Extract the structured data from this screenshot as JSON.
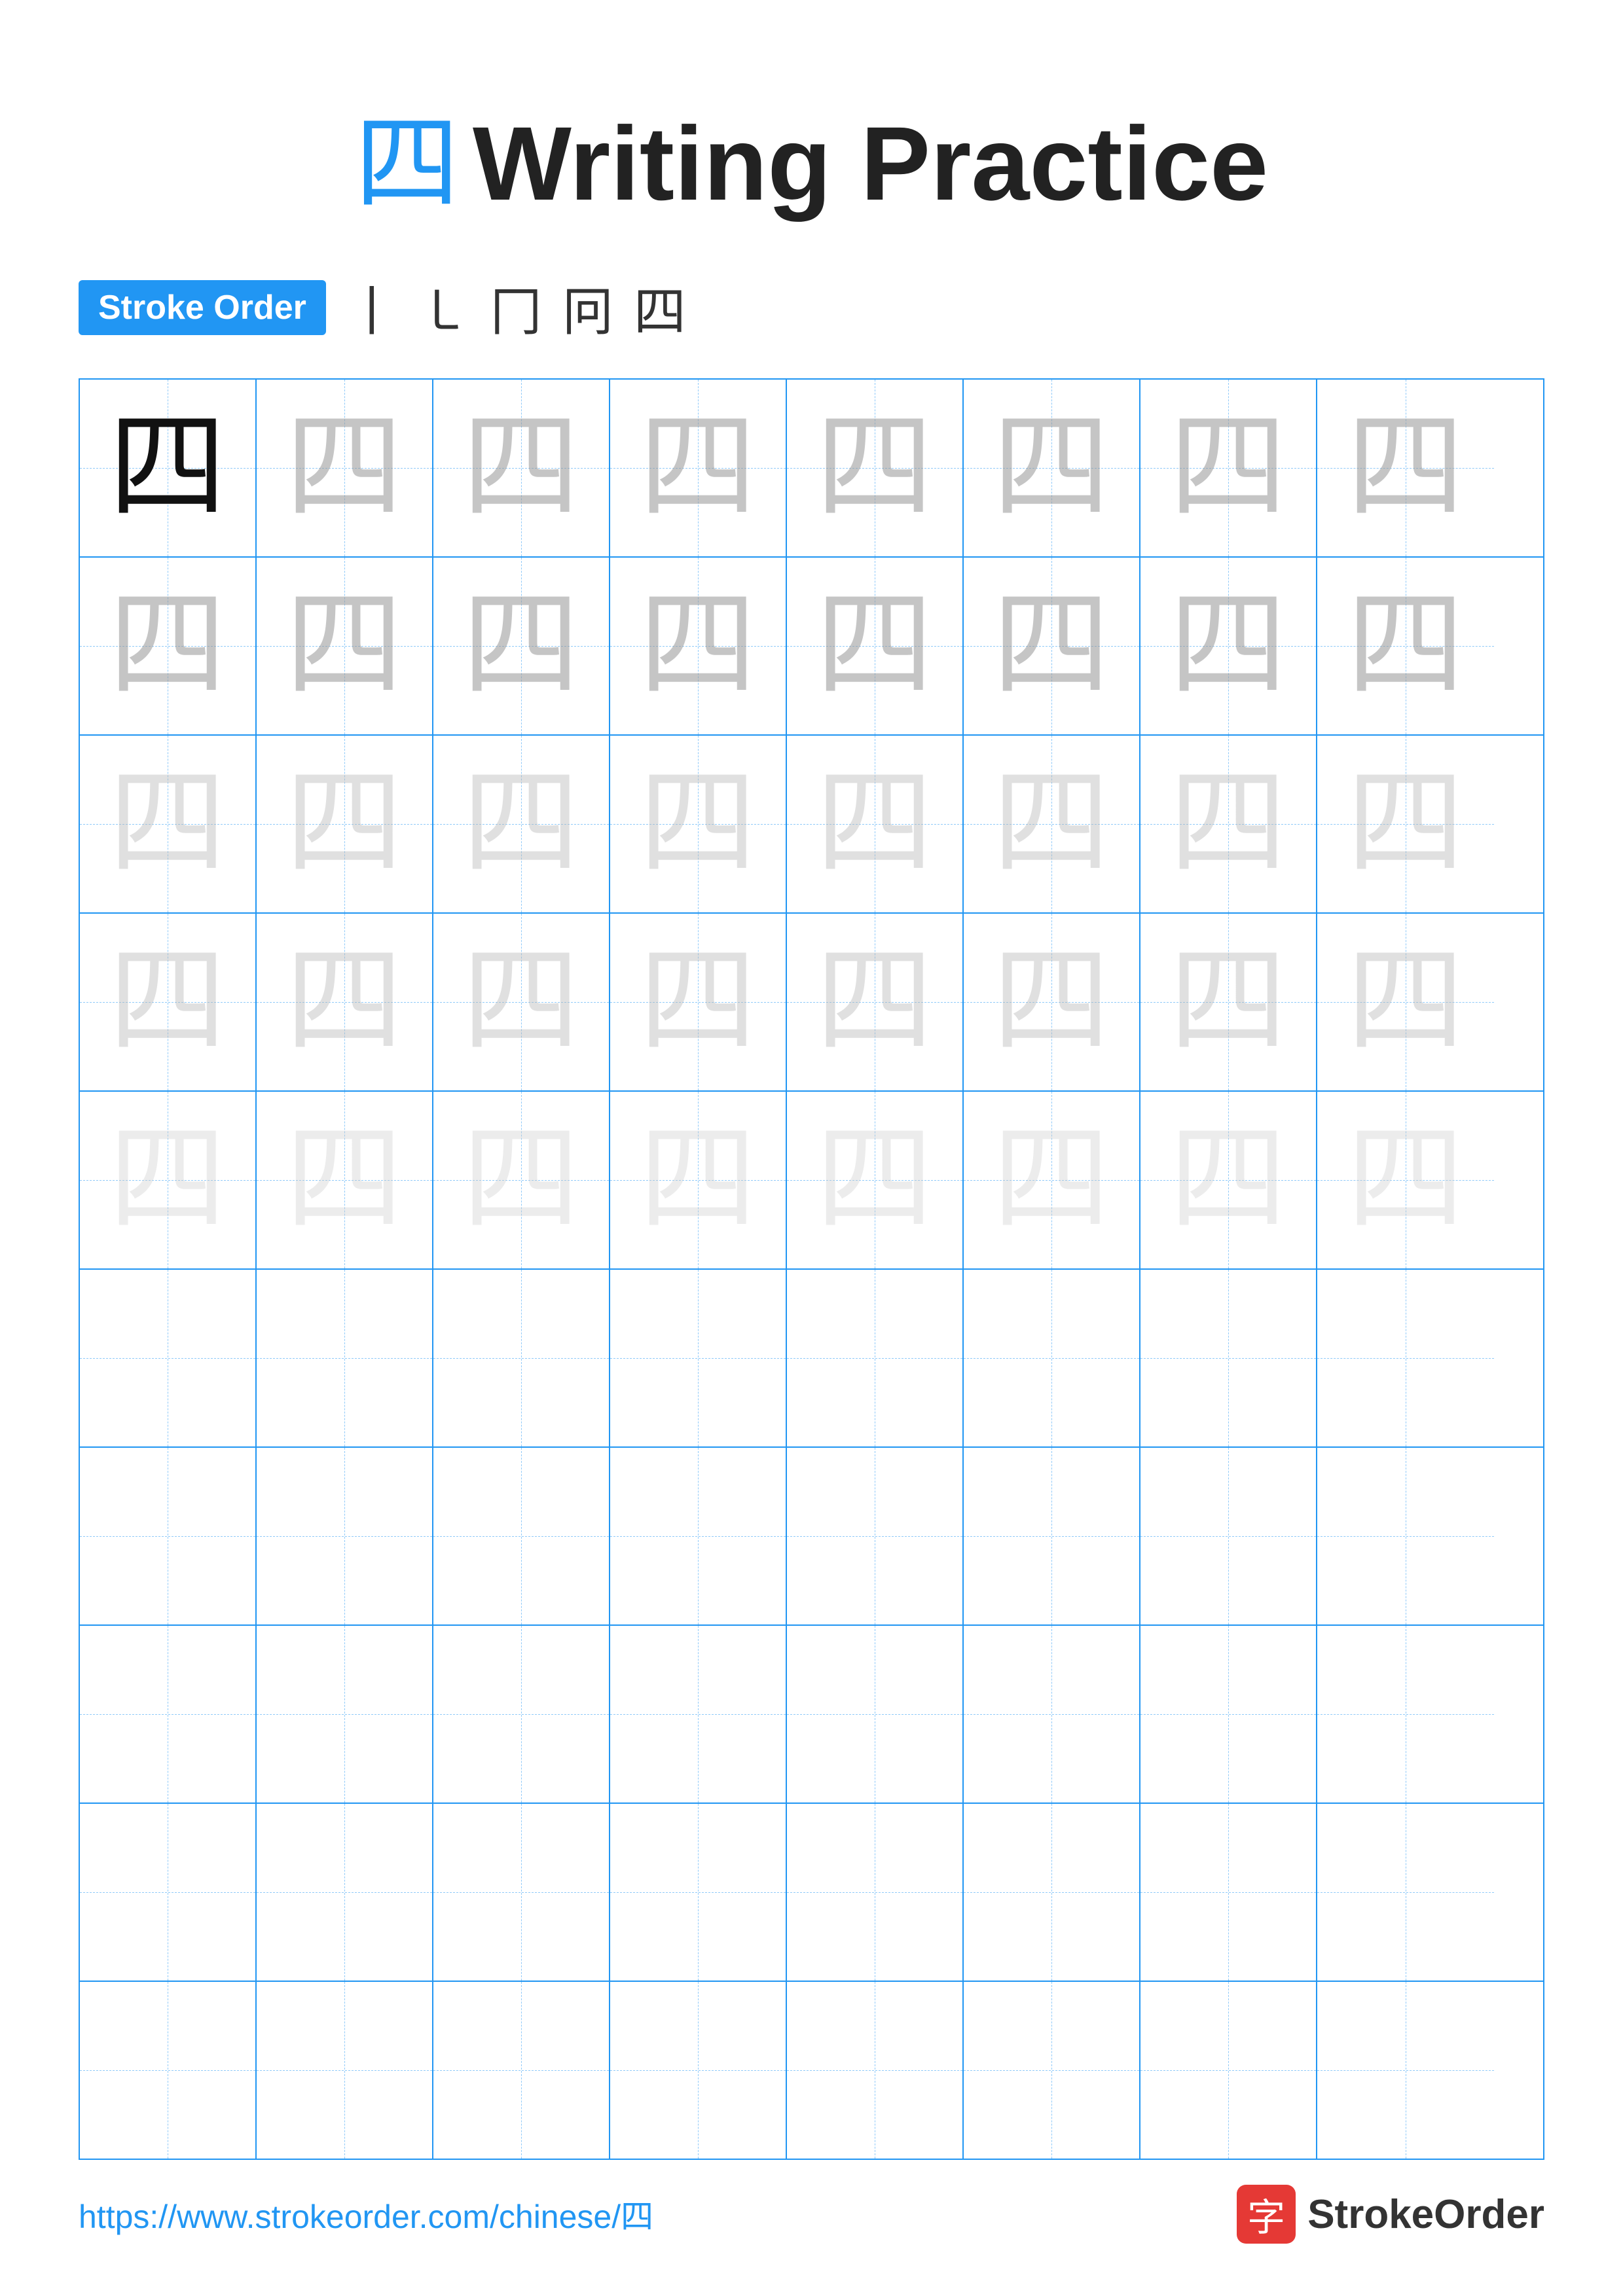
{
  "title": {
    "char": "四",
    "text": "Writing Practice"
  },
  "stroke_order": {
    "badge": "Stroke Order",
    "sequence": "丨　㇄　冂　冋　四"
  },
  "grid": {
    "rows": 10,
    "cols": 8,
    "char": "四",
    "guide_rows": 5,
    "empty_rows": 5
  },
  "footer": {
    "url": "https://www.strokeorder.com/chinese/四",
    "brand_char": "字",
    "brand_name": "StrokeOrder"
  }
}
